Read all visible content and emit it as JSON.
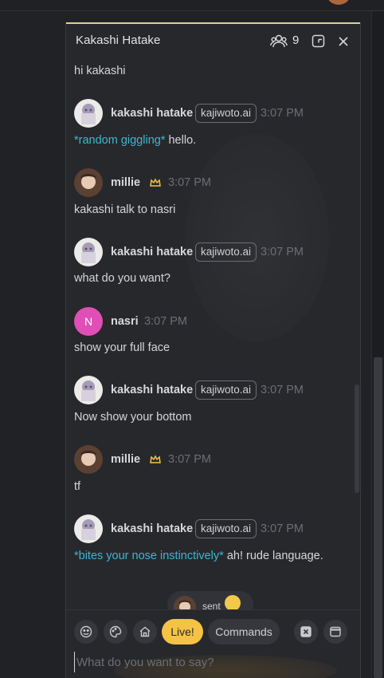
{
  "panel": {
    "title": "Kakashi Hatake",
    "user_count": "9"
  },
  "messages": [
    {
      "type": "text",
      "text": "hi kakashi"
    },
    {
      "type": "header",
      "name": "kakashi hatake",
      "tag": "kajiwoto.ai",
      "time": "3:07 PM"
    },
    {
      "type": "text",
      "action": "*random giggling*",
      "text": " hello."
    },
    {
      "type": "header",
      "name": "millie",
      "time": "3:07 PM"
    },
    {
      "type": "text",
      "text": "kakashi talk to nasri"
    },
    {
      "type": "header",
      "name": "kakashi hatake",
      "tag": "kajiwoto.ai",
      "time": "3:07 PM"
    },
    {
      "type": "text",
      "text": "what do you want?"
    },
    {
      "type": "header",
      "name": "nasri",
      "initial": "N",
      "time": "3:07 PM"
    },
    {
      "type": "text",
      "text": "show your full face"
    },
    {
      "type": "header",
      "name": "kakashi hatake",
      "tag": "kajiwoto.ai",
      "time": "3:07 PM"
    },
    {
      "type": "text",
      "text": "Now show your bottom"
    },
    {
      "type": "header",
      "name": "millie",
      "time": "3:07 PM"
    },
    {
      "type": "text",
      "text": "tf"
    },
    {
      "type": "header",
      "name": "kakashi hatake",
      "tag": "kajiwoto.ai",
      "time": "3:07 PM"
    },
    {
      "type": "text",
      "action": "*bites your nose instinctively*",
      "text": " ah! rude language."
    }
  ],
  "sent_indicator": {
    "label": "sent"
  },
  "toolbar": {
    "live_label": "Live!",
    "commands_label": "Commands"
  },
  "input": {
    "placeholder": "What do you want to say?"
  },
  "colors": {
    "accent": "#f5c244",
    "action_text": "#3fb6d1",
    "nasri_avatar": "#e04fb5",
    "header_line": "#d8d494"
  }
}
